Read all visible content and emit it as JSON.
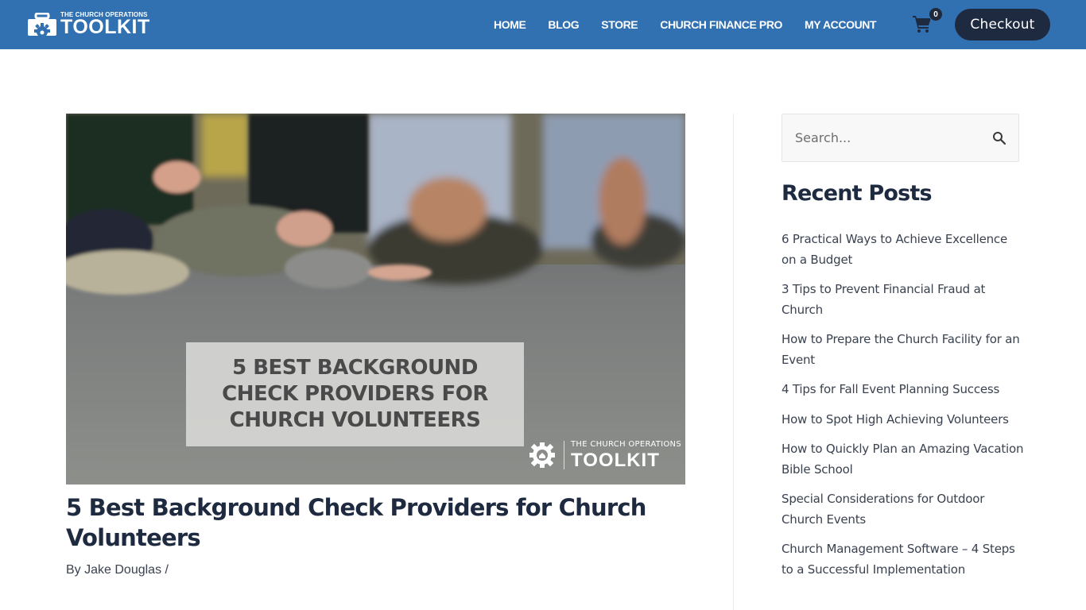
{
  "header": {
    "logo": {
      "small_text": "THE CHURCH OPERATIONS",
      "big_text": "TOOLKIT"
    },
    "nav": [
      {
        "label": "HOME"
      },
      {
        "label": "BLOG"
      },
      {
        "label": "STORE"
      },
      {
        "label": "CHURCH FINANCE PRO"
      },
      {
        "label": "MY ACCOUNT"
      }
    ],
    "cart": {
      "icon": "shopping-cart-icon",
      "count": "0"
    },
    "checkout_label": "Checkout"
  },
  "featured_image": {
    "overlay_lines": [
      "5 BEST BACKGROUND",
      "CHECK PROVIDERS FOR",
      "CHURCH VOLUNTEERS"
    ],
    "watermark_small": "THE CHURCH OPERATIONS",
    "watermark_big": "TOOLKIT"
  },
  "post": {
    "title": "5 Best Background Check Providers for Church Volunteers",
    "meta_prefix": "By ",
    "author": "Jake Douglas",
    "meta_separator": " /"
  },
  "sidebar": {
    "search": {
      "placeholder": "Search...",
      "icon": "search-icon"
    },
    "recent_heading": "Recent Posts",
    "recent_posts": [
      {
        "title": "6 Practical Ways to Achieve Excellence on a Budget"
      },
      {
        "title": "3 Tips to Prevent Financial Fraud at Church"
      },
      {
        "title": "How to Prepare the Church Facility for an Event"
      },
      {
        "title": "4 Tips for Fall Event Planning Success"
      },
      {
        "title": "How to Spot High Achieving Volunteers"
      },
      {
        "title": "How to Quickly Plan an Amazing Vacation Bible School"
      },
      {
        "title": "Special Considerations for Outdoor Church Events"
      },
      {
        "title": "Church Management Software – 4 Steps to a Successful Implementation"
      }
    ]
  },
  "colors": {
    "header_bg": "#3171b1",
    "checkout_bg": "#1e2a3f",
    "heading_text": "#1e2a3f",
    "body_text": "#3a4250"
  }
}
